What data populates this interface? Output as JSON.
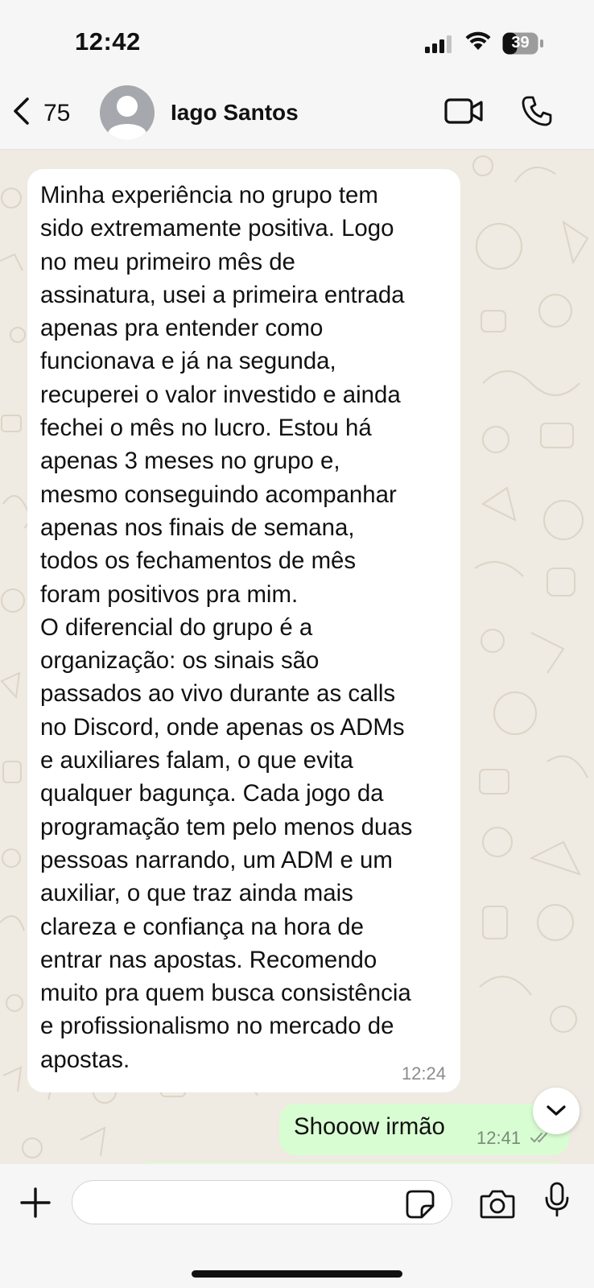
{
  "status_bar": {
    "time": "12:42",
    "battery_level": "39"
  },
  "header": {
    "back_count": "75",
    "contact_name": "Iago Santos"
  },
  "messages": [
    {
      "direction": "incoming",
      "text": "Minha experiência no grupo tem\nsido extremamente positiva. Logo\nno meu primeiro mês de\nassinatura, usei a primeira entrada\napenas pra entender como\nfuncionava e já na segunda,\nrecuperei o valor investido e ainda\nfechei o mês no lucro. Estou há\napenas 3 meses no grupo e,\nmesmo conseguindo acompanhar\napenas nos finais de semana,\ntodos os fechamentos de mês\nforam positivos pra mim.\nO diferencial do grupo é a\norganização: os sinais são\npassados ao vivo durante as calls\nno Discord, onde apenas os ADMs\ne auxiliares falam, o que evita\nqualquer bagunça. Cada jogo da\nprogramação tem pelo menos duas\npessoas narrando, um ADM e um\nauxiliar, o que traz ainda mais\nclareza e confiança na hora de\nentrar nas apostas. Recomendo\nmuito pra quem busca consistência\ne profissionalismo no mercado de\napostas.",
      "time": "12:24"
    },
    {
      "direction": "outgoing",
      "text": "Shooow irmão",
      "time": "12:41",
      "status": "read"
    }
  ],
  "composer": {
    "value": "",
    "placeholder": ""
  },
  "colors": {
    "chat_background": "#efeae2",
    "incoming_bubble": "#ffffff",
    "outgoing_bubble": "#d9fdd3",
    "bar_background": "#f6f6f6"
  }
}
